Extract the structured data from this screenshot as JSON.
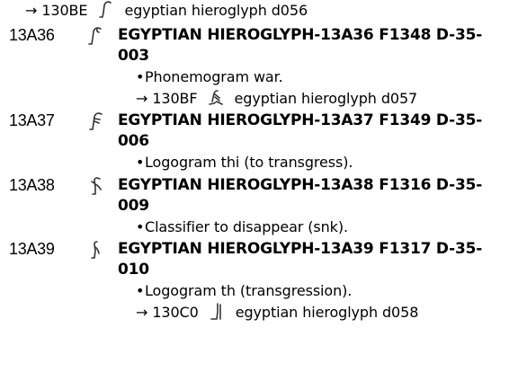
{
  "entries_top": {
    "xref_code": "130BE",
    "xref_arrow": "→",
    "xref_glyph_icon": "hieroglyph-d056-icon",
    "xref_name": "egyptian hieroglyph d056"
  },
  "entries": [
    {
      "code": "13A36",
      "glyph_icon": "hieroglyph-13a36-icon",
      "name_line1": "EGYPTIAN HIEROGLYPH-13A36 F1348 D-35-",
      "name_line2": "003",
      "note": "Phonemogram war.",
      "xref_arrow": "→",
      "xref_code": "130BF",
      "xref_glyph_icon": "hieroglyph-d057-icon",
      "xref_name": "egyptian hieroglyph d057"
    },
    {
      "code": "13A37",
      "glyph_icon": "hieroglyph-13a37-icon",
      "name_line1": "EGYPTIAN HIEROGLYPH-13A37 F1349 D-35-",
      "name_line2": "006",
      "note": "Logogram thi (to transgress)."
    },
    {
      "code": "13A38",
      "glyph_icon": "hieroglyph-13a38-icon",
      "name_line1": "EGYPTIAN HIEROGLYPH-13A38 F1316 D-35-",
      "name_line2": "009",
      "note": "Classifier to disappear (snk)."
    },
    {
      "code": "13A39",
      "glyph_icon": "hieroglyph-13a39-icon",
      "name_line1": "EGYPTIAN HIEROGLYPH-13A39 F1317 D-35-",
      "name_line2": "010",
      "note": "Logogram th (transgression).",
      "xref_arrow": "→",
      "xref_code": "130C0",
      "xref_glyph_icon": "hieroglyph-d058-icon",
      "xref_name": "egyptian hieroglyph d058"
    }
  ],
  "bullet": "•"
}
